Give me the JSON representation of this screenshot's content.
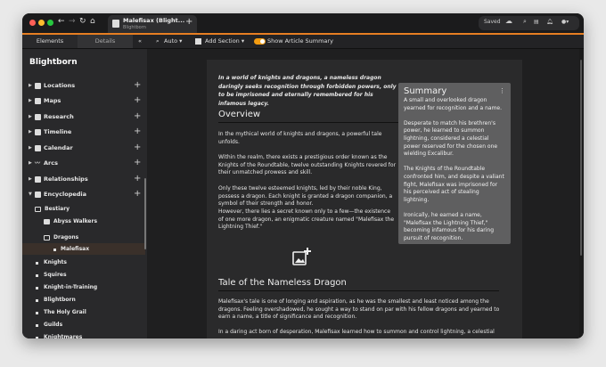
{
  "window": {
    "tab_title": "Malefisax (Blight...",
    "tab_subtitle": "Blightborn",
    "saved": "Saved"
  },
  "sidebar": {
    "tabs": [
      "Elements",
      "Details"
    ],
    "collapse": "«",
    "world": "Blightborn",
    "categories": [
      {
        "label": "Locations"
      },
      {
        "label": "Maps"
      },
      {
        "label": "Research"
      },
      {
        "label": "Timeline"
      },
      {
        "label": "Calendar"
      },
      {
        "label": "Arcs"
      },
      {
        "label": "Relationships"
      },
      {
        "label": "Encyclopedia"
      }
    ],
    "tree": {
      "bestiary": "Bestiary",
      "abyss": "Abyss Walkers",
      "dragons": "Dragons",
      "selected": "Malefisax"
    },
    "entries": [
      "Knights",
      "Squires",
      "Knight-in-Training",
      "Blightborn",
      "The Holy Grail",
      "Guilds",
      "Knightmares"
    ]
  },
  "toolbar": {
    "zoom": "Auto",
    "add_section": "Add Section",
    "summary_toggle": "Show Article Summary",
    "summary_on": true
  },
  "article": {
    "intro": "In a world of knights and dragons, a nameless dragon daringly seeks recognition through forbidden powers, only to be imprisoned and eternally remembered for his infamous legacy.",
    "overview_title": "Overview",
    "overview": [
      "In the mythical world of knights and dragons, a powerful tale unfolds.",
      "Within the realm, there exists a prestigious order known as the Knights of the Roundtable, twelve outstanding Knights revered for their unmatched prowess and skill.",
      "Only these twelve esteemed knights, led by their noble King, possess a dragon. Each knight is granted a dragon companion, a symbol of their strength and honor.",
      "However, there lies a secret known only to a few—the existence of one more dragon, an enigmatic creature named \"Malefisax the Lightning Thief.\""
    ],
    "tale_title": "Tale of the Nameless Dragon",
    "tale": [
      "Malefisax's tale is one of longing and aspiration, as he was the smallest and least noticed among the dragons. Feeling overshadowed, he sought a way to stand on par with his fellow dragons and yearned to earn a name, a title of significance and recognition.",
      "In a daring act born of desperation, Malefisax learned how to summon and control lightning, a celestial"
    ]
  },
  "summary": {
    "title": "Summary",
    "paragraphs": [
      "A small and overlooked dragon yearned for recognition and a name.",
      "Desperate to match his brethren's power, he learned to summon lightning, considered a celestial power reserved for the chosen one wielding Excalibur.",
      "The Knights of the Roundtable confronted him, and despite a valiant fight, Malefisax was imprisoned for his perceived act of stealing lightning.",
      "Ironically, he earned a name, \"Malefisax the Lightning Thief,\" becoming infamous for his daring pursuit of recognition."
    ]
  }
}
